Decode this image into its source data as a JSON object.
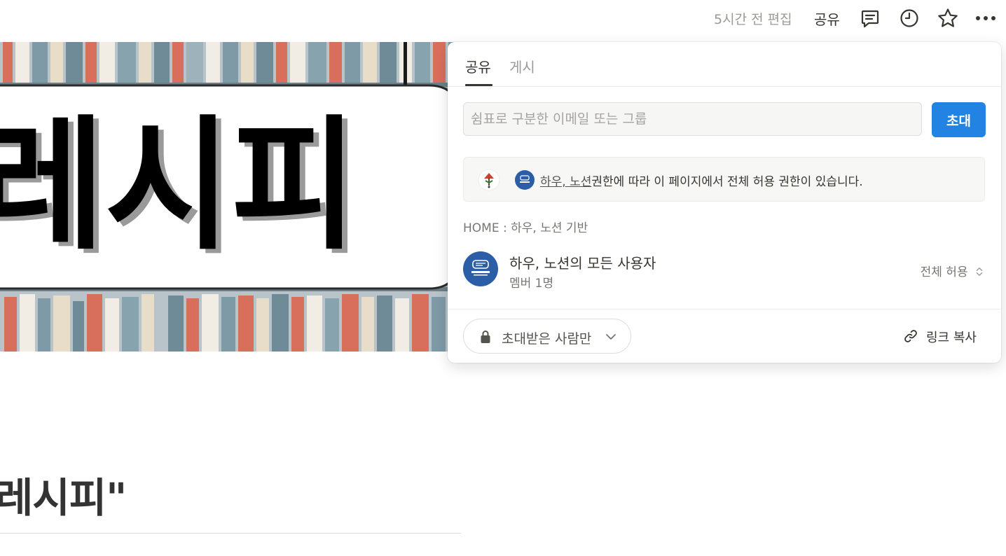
{
  "topbar": {
    "edited": "5시간 전 편집",
    "share_label": "공유"
  },
  "cover": {
    "title_text": "레시피"
  },
  "page": {
    "heading": "레시피\""
  },
  "share_popup": {
    "tabs": [
      {
        "label": "공유",
        "active": true
      },
      {
        "label": "게시",
        "active": false
      }
    ],
    "invite": {
      "placeholder": "쉼표로 구분한 이메일 또는 그룹",
      "value": "",
      "button_label": "초대"
    },
    "notice": {
      "link_text": "하우, 노션",
      "text": "권한에 따라 이 페이지에서 전체 허용 권한이 있습니다."
    },
    "group_label": "HOME : 하우, 노션 기반",
    "member": {
      "name": "하우, 노션의 모든 사용자",
      "sub": "멤버 1명",
      "permission": "전체 허용"
    },
    "footer": {
      "access_label": "초대받은 사람만",
      "copy_link_label": "링크 복사"
    }
  },
  "colors": {
    "accent": "#2383e2",
    "avatar": "#2b5ea7"
  },
  "icons": [
    "comment-icon",
    "history-icon",
    "star-icon",
    "more-icon",
    "lock-icon",
    "chevron-down-icon",
    "link-icon",
    "sort-icon"
  ]
}
